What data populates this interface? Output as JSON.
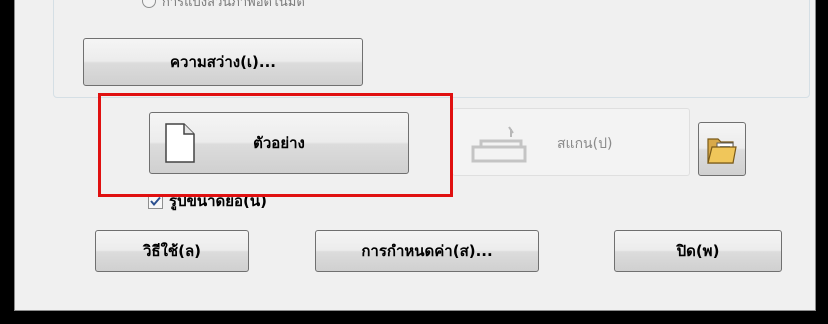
{
  "radio_option": {
    "label": "การแบ่งส่วนภาพอัตโนมัติ"
  },
  "buttons": {
    "brightness": "ความสว่าง(เ)...",
    "preview": "ตัวอย่าง",
    "scan": "สแกน(ป)",
    "help": "วิธีใช้(ล)",
    "settings": "การกำหนดค่า(ส)...",
    "close": "ปิด(พ)"
  },
  "thumbnail_checkbox": {
    "label": "รูปขนาดย่อ(น)",
    "checked": true
  },
  "icons": {
    "preview": "document-icon",
    "scan": "scanner-icon",
    "folder": "folder-icon"
  },
  "colors": {
    "highlight": "#e01010",
    "window_bg": "#f0f0f0"
  }
}
